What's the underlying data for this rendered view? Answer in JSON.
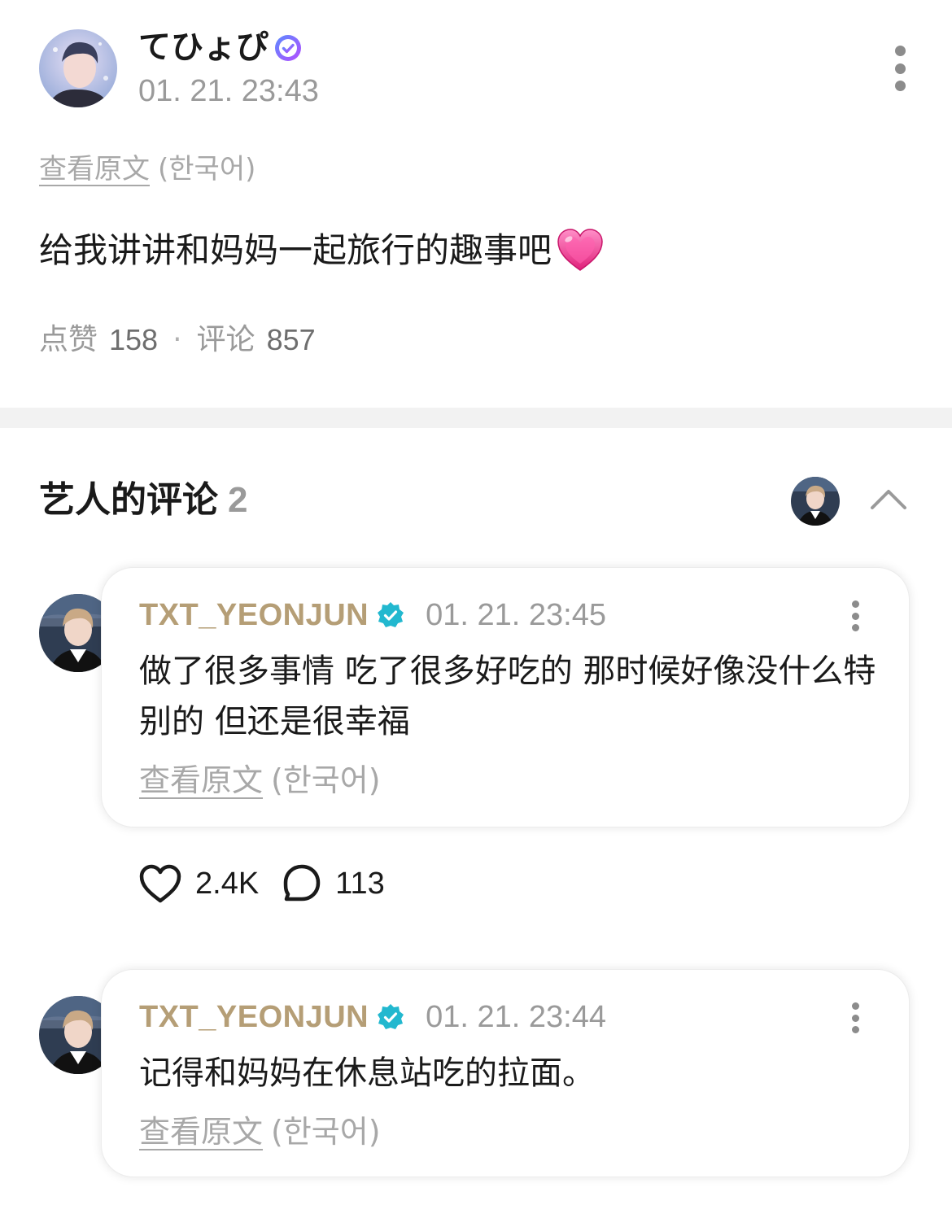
{
  "post": {
    "author": "てひょぴ",
    "time": "01. 21. 23:43",
    "translate_link": "查看原文",
    "translate_lang": "(한국어)",
    "body": "给我讲讲和妈妈一起旅行的趣事吧",
    "emoji": "pink-heart-emoji",
    "likes_label": "点赞",
    "likes": "158",
    "separator": "·",
    "comments_label": "评论",
    "comments": "857"
  },
  "artist_comments": {
    "title": "艺人的评论",
    "count": "2",
    "items": [
      {
        "author": "TXT_YEONJUN",
        "time": "01. 21. 23:45",
        "text": "做了很多事情 吃了很多好吃的 那时候好像没什么特别的 但还是很幸福",
        "translate_link": "查看原文",
        "translate_lang": "(한국어)",
        "likes": "2.4K",
        "replies": "113"
      },
      {
        "author": "TXT_YEONJUN",
        "time": "01. 21. 23:44",
        "text": "记得和妈妈在休息站吃的拉面。",
        "translate_link": "查看原文",
        "translate_lang": "(한국어)"
      }
    ]
  },
  "colors": {
    "artist_name": "#b59e76",
    "verified_teal": "#22b8cf",
    "verified_purple": "#7b5cff",
    "muted_text": "#9a9a9a",
    "divider": "#f2f2f2"
  }
}
